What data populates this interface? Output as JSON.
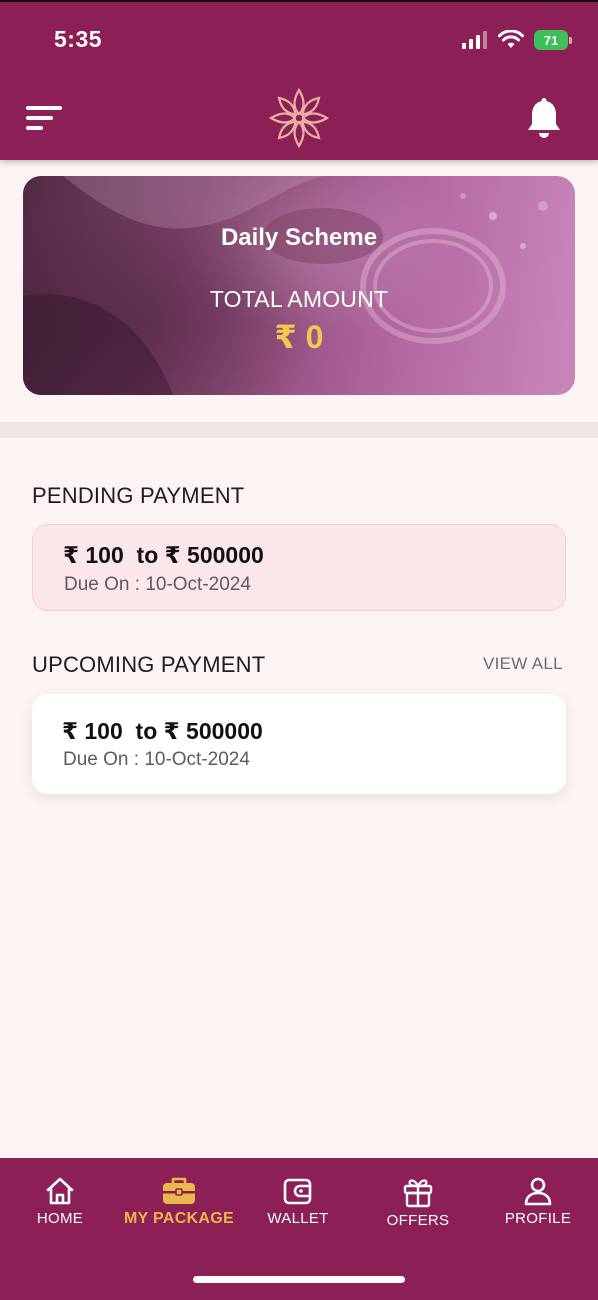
{
  "status_bar": {
    "time": "5:35",
    "battery": "71"
  },
  "banner": {
    "title": "Daily Scheme",
    "subtitle": "TOTAL AMOUNT",
    "amount": "₹ 0"
  },
  "pending": {
    "title": "PENDING PAYMENT",
    "range": "₹ 100  to ₹ 500000",
    "due": "Due On : 10-Oct-2024"
  },
  "upcoming": {
    "title": "UPCOMING PAYMENT",
    "view_all": "VIEW ALL",
    "range": "₹ 100  to ₹ 500000",
    "due": "Due On : 10-Oct-2024"
  },
  "nav": {
    "items": [
      {
        "label": "HOME",
        "icon": "home-icon"
      },
      {
        "label": "MY PACKAGE",
        "icon": "briefcase-icon"
      },
      {
        "label": "WALLET",
        "icon": "wallet-icon"
      },
      {
        "label": "OFFERS",
        "icon": "gift-icon"
      },
      {
        "label": "PROFILE",
        "icon": "user-icon"
      }
    ],
    "active_index": 1
  },
  "colors": {
    "brand": "#8c1f55",
    "accent_gold": "#e9b84a",
    "amount_gold": "#f2c94c",
    "background": "#fcf4f2",
    "pending_card": "#fbe7ea",
    "battery_green": "#3dbf5a"
  }
}
